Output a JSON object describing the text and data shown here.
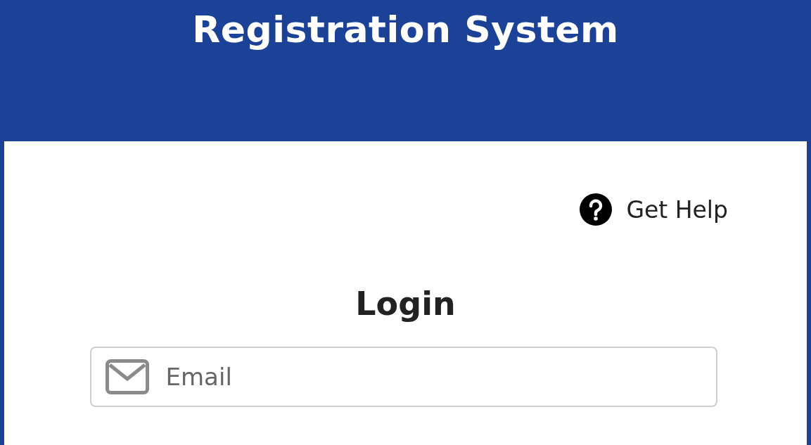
{
  "header": {
    "title": "Registration System"
  },
  "help_link": {
    "label": "Get Help"
  },
  "login": {
    "heading": "Login",
    "email_field": {
      "placeholder": "Email"
    }
  }
}
